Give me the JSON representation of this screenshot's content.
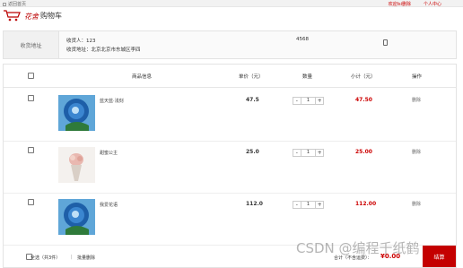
{
  "topbar": {
    "home_link": "返回首页",
    "welcome": "欢迎lsi删除",
    "user_center": "个人中心"
  },
  "header": {
    "logo_text": "花舍",
    "page_title": "购物车"
  },
  "address": {
    "label": "收货地址",
    "receiver": "收货人：123",
    "detail": "收货地址：北京北京市东城区李四",
    "phone": "4568"
  },
  "cart": {
    "columns": [
      "商品信息",
      "单价（元）",
      "数量",
      "小计（元）",
      "操作"
    ],
    "items": [
      {
        "name": "蓝天蓝·浅刻",
        "price": "47.5",
        "qty": "1",
        "subtotal": "47.50",
        "delete": "删除",
        "minus": "-",
        "plus": "+"
      },
      {
        "name": "甜蜜公主",
        "price": "25.0",
        "qty": "1",
        "subtotal": "25.00",
        "delete": "删除",
        "minus": "-",
        "plus": "+"
      },
      {
        "name": "我爱花语",
        "price": "112.0",
        "qty": "1",
        "subtotal": "112.00",
        "delete": "删除",
        "minus": "-",
        "plus": "+"
      }
    ],
    "footer": {
      "select_all": "全选（共3件）",
      "separator": "|",
      "batch_delete": "批量删除",
      "total_label": "合计（不含运费）：",
      "total": "¥0.00",
      "checkout": "结算"
    }
  },
  "watermark": "CSDN @编程千纸鹤",
  "colors": {
    "accent": "#c40000",
    "price_red": "#cc0000"
  }
}
